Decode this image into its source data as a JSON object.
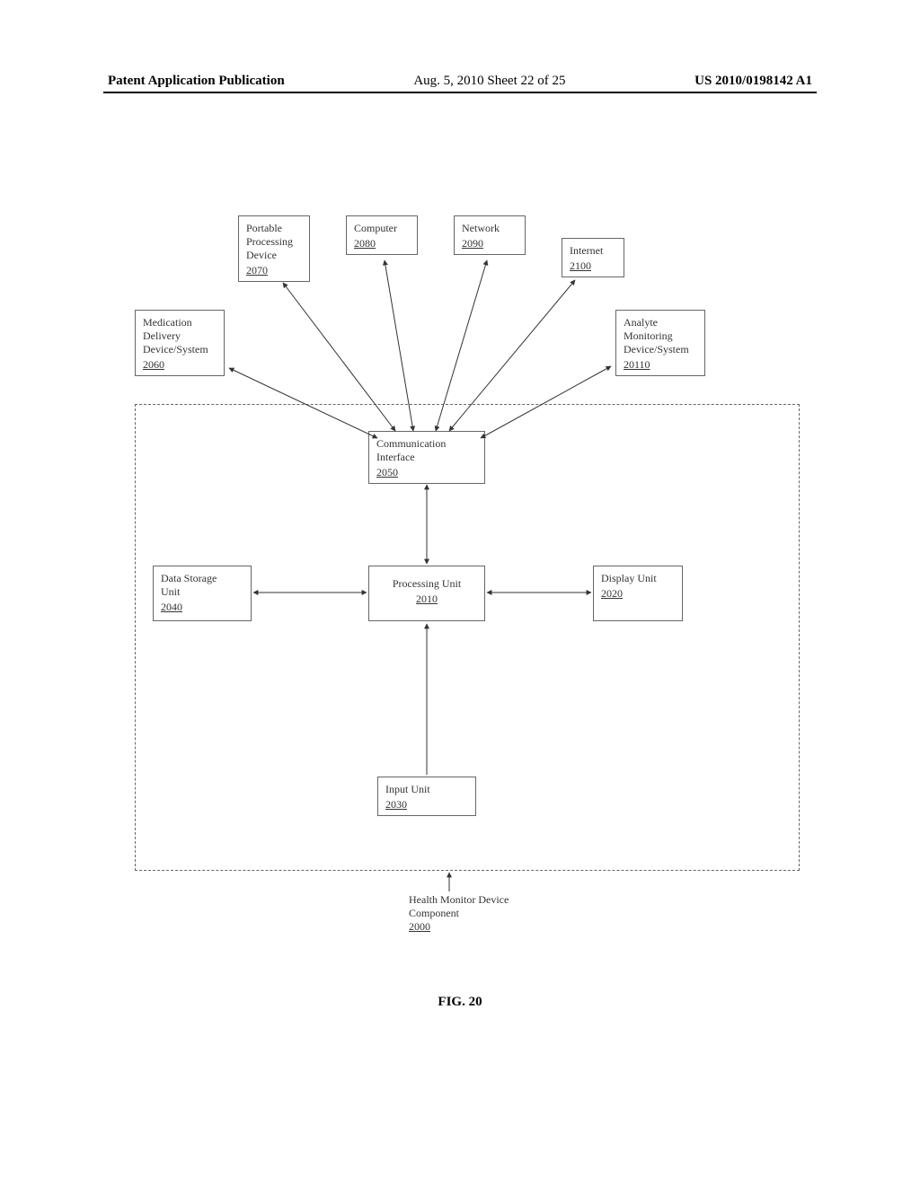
{
  "header": {
    "left": "Patent Application Publication",
    "mid": "Aug. 5, 2010  Sheet 22 of 25",
    "right": "US 2010/0198142 A1"
  },
  "boxes": {
    "portable": {
      "label": "Portable\nProcessing\nDevice",
      "ref": "2070"
    },
    "computer": {
      "label": "Computer",
      "ref": "2080"
    },
    "network": {
      "label": "Network",
      "ref": "2090"
    },
    "internet": {
      "label": "Internet",
      "ref": "2100"
    },
    "medication": {
      "label": "Medication\nDelivery\nDevice/System",
      "ref": "2060"
    },
    "analyte": {
      "label": "Analyte\nMonitoring\nDevice/System",
      "ref": "20110"
    },
    "comm": {
      "label": "Communication\nInterface",
      "ref": "2050"
    },
    "storage": {
      "label": "Data Storage\nUnit",
      "ref": "2040"
    },
    "processing": {
      "label": "Processing Unit",
      "ref": "2010"
    },
    "display": {
      "label": "Display Unit",
      "ref": "2020"
    },
    "input": {
      "label": "Input Unit",
      "ref": "2030"
    }
  },
  "health": {
    "label": "Health Monitor Device\nComponent",
    "ref": "2000"
  },
  "figure_caption": "FIG. 20"
}
